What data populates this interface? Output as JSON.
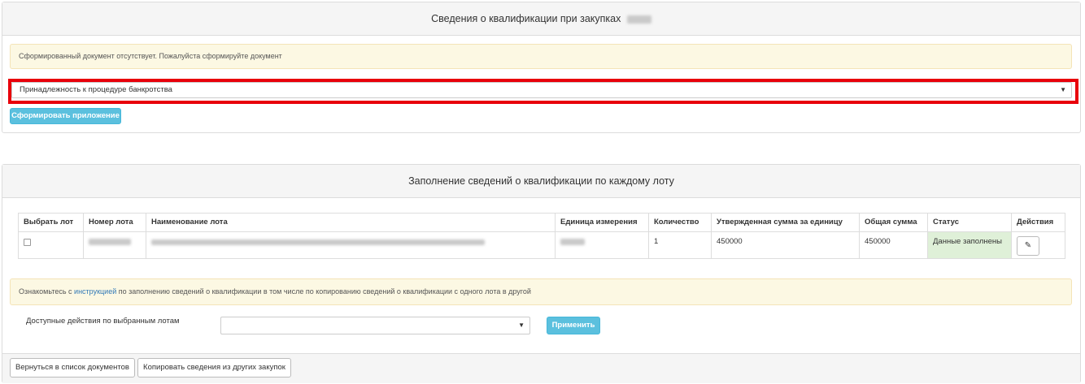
{
  "section1": {
    "title": "Сведения о квалификации при закупках",
    "alert": "Сформированный документ отсутствует. Пожалуйста сформируйте документ",
    "select_value": "Принадлежность к процедуре банкротства",
    "generate_button": "Сформировать приложение"
  },
  "section2": {
    "title": "Заполнение сведений о квалификации по каждому лоту",
    "table": {
      "headers": [
        "Выбрать лот",
        "Номер лота",
        "Наименование лота",
        "Единица измерения",
        "Количество",
        "Утвержденная сумма за единицу",
        "Общая сумма",
        "Статус",
        "Действия"
      ],
      "rows": [
        {
          "quantity": "1",
          "unit_sum": "450000",
          "total_sum": "450000",
          "status": "Данные заполнены"
        }
      ]
    },
    "info": {
      "prefix": "Ознакомьтесь с ",
      "link": "инструкцией",
      "suffix": " по заполнению сведений о квалификации в том числе по копированию сведений о квалификации с одного лота в другой"
    },
    "bulk_actions_label": "Доступные действия по выбранным лотам",
    "bulk_actions_value": "",
    "apply_button": "Применить"
  },
  "footer": {
    "back_button": "Вернуться в список документов",
    "copy_button": "Копировать сведения из других закупок"
  },
  "colors": {
    "highlight": "#e8000b",
    "info_button": "#5bc0de",
    "alert_bg": "#fcf8e3",
    "status_bg": "#dff0d8"
  }
}
